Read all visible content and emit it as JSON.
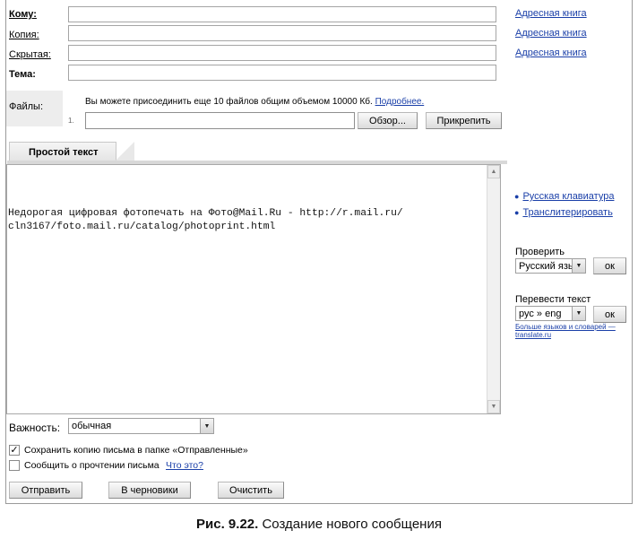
{
  "header": {
    "to_label": "Кому:",
    "cc_label": "Копия:",
    "bcc_label": "Скрытая:",
    "subject_label": "Тема:",
    "address_book": "Адресная книга"
  },
  "files": {
    "label": "Файлы:",
    "info": "Вы можете присоединить еще 10 файлов общим объемом 10000 Кб.",
    "more_link": "Подробнее.",
    "row_number": "1.",
    "browse_button": "Обзор...",
    "attach_button": "Прикрепить"
  },
  "editor": {
    "tab_label": "Простой текст",
    "body_line1": "Недорогая цифровая фотопечать на Фото@Mail.Ru - http://r.mail.ru/",
    "body_line2": "cln3167/foto.mail.ru/catalog/photoprint.html"
  },
  "sidebar": {
    "russian_keyboard": "Русская клавиатура",
    "transliterate": "Транслитерировать",
    "check_label": "Проверить",
    "check_lang_value": "Русский язык",
    "ok": "ок",
    "translate_label": "Перевести текст",
    "translate_value": "рус » eng",
    "dictionaries_line1": "Больше языков и словарей —",
    "dictionaries_line2": "translate.ru"
  },
  "footer": {
    "importance_label": "Важность:",
    "importance_value": "обычная",
    "save_copy": "Сохранить копию письма в папке «Отправленные»",
    "save_copy_checked": true,
    "read_receipt": "Сообщить о прочтении письма",
    "read_receipt_checked": false,
    "what_is_it": "Что это?",
    "send_button": "Отправить",
    "drafts_button": "В черновики",
    "clear_button": "Очистить"
  },
  "caption": {
    "figure": "Рис. 9.22.",
    "text": " Создание нового сообщения"
  },
  "icons": {
    "checkmark": "check-icon",
    "dropdown": "chevron-down-icon",
    "scroll_up": "arrow-up-icon",
    "scroll_down": "arrow-down-icon",
    "bullet": "bullet-icon"
  }
}
